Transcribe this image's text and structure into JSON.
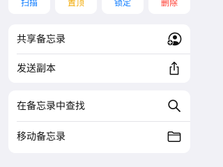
{
  "actions": [
    {
      "label": "扫描",
      "color": "#0a7aff"
    },
    {
      "label": "置顶",
      "color": "#f2a800"
    },
    {
      "label": "锁定",
      "color": "#0a7aff"
    },
    {
      "label": "删除",
      "color": "#ff3b30"
    }
  ],
  "menu_group_1": [
    {
      "label": "共享备忘录",
      "icon": "share-person-add-icon"
    },
    {
      "label": "发送副本",
      "icon": "share-upload-icon"
    }
  ],
  "menu_group_2": [
    {
      "label": "在备忘录中查找",
      "icon": "search-icon"
    },
    {
      "label": "移动备忘录",
      "icon": "folder-icon"
    }
  ],
  "colors": {
    "background": "#f1f1f6",
    "card": "#ffffff",
    "text": "#111111",
    "icon": "#111111"
  }
}
